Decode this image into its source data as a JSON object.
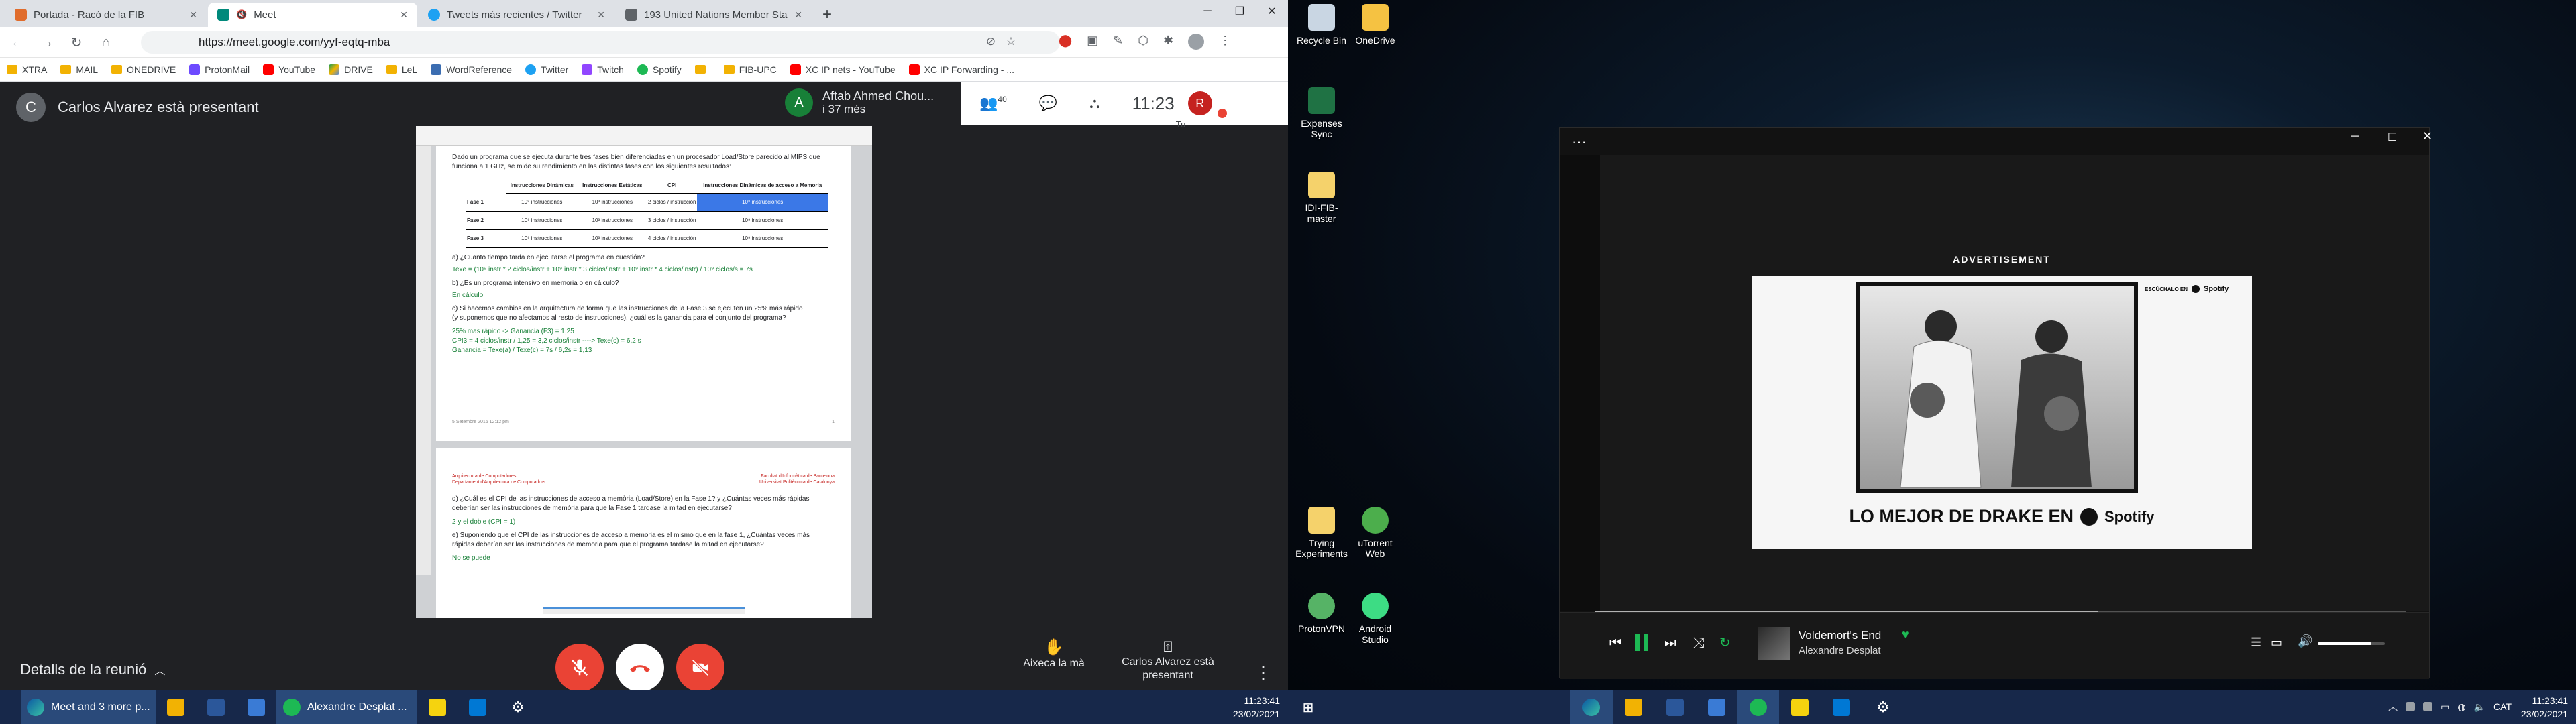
{
  "chrome": {
    "tabs": [
      {
        "title": "Portada - Racó de la FIB",
        "active": false,
        "color": "#e06c2c"
      },
      {
        "title": "Meet",
        "active": true,
        "color": "#00897b"
      },
      {
        "title": "Tweets más recientes / Twitter",
        "active": false,
        "color": "#1da1f2"
      },
      {
        "title": "193 United Nations Member Sta",
        "active": false,
        "color": "#5f6368"
      }
    ],
    "new_tab": "+",
    "url": "https://meet.google.com/yyf-eqtq-mba",
    "profile": "R",
    "bookmarks": [
      "XTRA",
      "MAIL",
      "ONEDRIVE",
      "ProtonMail",
      "YouTube",
      "DRIVE",
      "LeL",
      "WordReference",
      "Twitter",
      "Twitch",
      "Spotify",
      "",
      "FIB-UPC",
      "XC IP nets - YouTube",
      "XC IP Forwarding - ..."
    ]
  },
  "meet": {
    "presenter_initial": "C",
    "presenter_text": "Carlos Alvarez està presentant",
    "speaker_initial": "A",
    "speaker_name": "Aftab Ahmed Chou...",
    "speaker_sub": "i 37 més",
    "participants_count": "40",
    "time": "11:23",
    "you_label": "Tu",
    "you_initial": "R",
    "details_label": "Detalls de la reunió",
    "raise_hand": "Aixeca la mà",
    "present_label": "Carlos Alvarez està presentant"
  },
  "doc": {
    "intro": "Dado un programa que se ejecuta durante tres fases bien diferenciadas en un procesador Load/Store parecido al MIPS que funciona a 1 GHz, se mide su rendimiento en las distintas fases con los siguientes resultados:",
    "table_headers": [
      "",
      "Instrucciones Dinámicas",
      "Instrucciones Estáticas",
      "CPI",
      "Instrucciones Dinámicas de acceso a Memoria"
    ],
    "table_rows": [
      [
        "Fase 1",
        "10⁹ instrucciones",
        "10³ instrucciones",
        "2 ciclos / instrucción",
        "10⁸ instrucciones"
      ],
      [
        "Fase 2",
        "10⁹ instrucciones",
        "10³ instrucciones",
        "3 ciclos / instrucción",
        "10⁹ instrucciones"
      ],
      [
        "Fase 3",
        "10⁹ instrucciones",
        "10³ instrucciones",
        "4 ciclos / instrucción",
        "10⁹ instrucciones"
      ]
    ],
    "qa": "a)   ¿Cuanto tiempo tarda en ejecutarse el programa en cuestión?",
    "aa": "Texe = (10⁹ instr * 2 ciclos/instr + 10⁹ instr * 3 ciclos/instr + 10⁹ instr * 4 ciclos/instr) / 10⁹ ciclos/s = 7s",
    "qb": "b)   ¿Es un programa intensivo en memoria o en cálculo?",
    "ab": "En cálculo",
    "qc": "c)   Si hacemos cambios en la arquitectura de forma que las instrucciones de la Fase 3 se ejecuten un 25% más rápido (y suponemos que no afectamos al resto de instrucciones), ¿cuál es la ganancia para el conjunto del programa?",
    "ac1": "25% mas rápido -> Ganancia (F3) = 1,25",
    "ac2": "CPI3 = 4 ciclos/instr / 1,25 = 3,2 ciclos/instr  ---->  Texe(c) = 6,2 s",
    "ac3": "Ganancia = Texe(a) / Texe(c) = 7s / 6,2s = 1,13",
    "footer1": "5 Setembre 2016 12:12 pm",
    "footer1_right": "1",
    "hdr_left1": "Arquitectura de Computadores",
    "hdr_left2": "Departament d'Arquitectura de Computadors",
    "hdr_right1": "Facultat d'Informàtica de Barcelona",
    "hdr_right2": "Universitat Politècnica de Catalunya",
    "qd": "d)   ¿Cuál es el CPI de las instrucciones de acceso a memòria (Load/Store) en la Fase 1? y ¿Cuántas veces más rápidas deberían ser las instrucciones de memòria para que la Fase 1 tardase la mitad en ejecutarse?",
    "ad": "2 y el doble (CPI = 1)",
    "qe": "e)   Suponiendo que el CPI de las instrucciones de acceso a memoria es el mismo que en la fase 1, ¿Cuántas veces más rápidas deberían ser las instrucciones de memoria para que el programa tardase la mitad en ejecutarse?",
    "ae": "No se puede"
  },
  "taskbar_left": {
    "meet_label": "Meet and 3 more p...",
    "spotify_label": "Alexandre Desplat ...",
    "time": "11:23:41",
    "date": "23/02/2021"
  },
  "desktop": {
    "icons": [
      "Recycle Bin",
      "OneDrive",
      "Expenses Sync",
      "IDI-FIB-master",
      "Trying Experiments",
      "uTorrent Web",
      "ProtonVPN",
      "Android Studio"
    ]
  },
  "spotify": {
    "ad_label": "ADVERTISEMENT",
    "ad_caption": "LO MEJOR DE DRAKE EN",
    "ad_brand": "Spotify",
    "ad_small": "ESCÚCHALO EN",
    "track": "Voldemort's End",
    "artist": "Alexandre Desplat",
    "progress": 0.62,
    "volume": 0.8,
    "accent": "#1db954"
  },
  "taskbar_right": {
    "lang": "CAT",
    "time": "11:23:41",
    "date": "23/02/2021"
  }
}
